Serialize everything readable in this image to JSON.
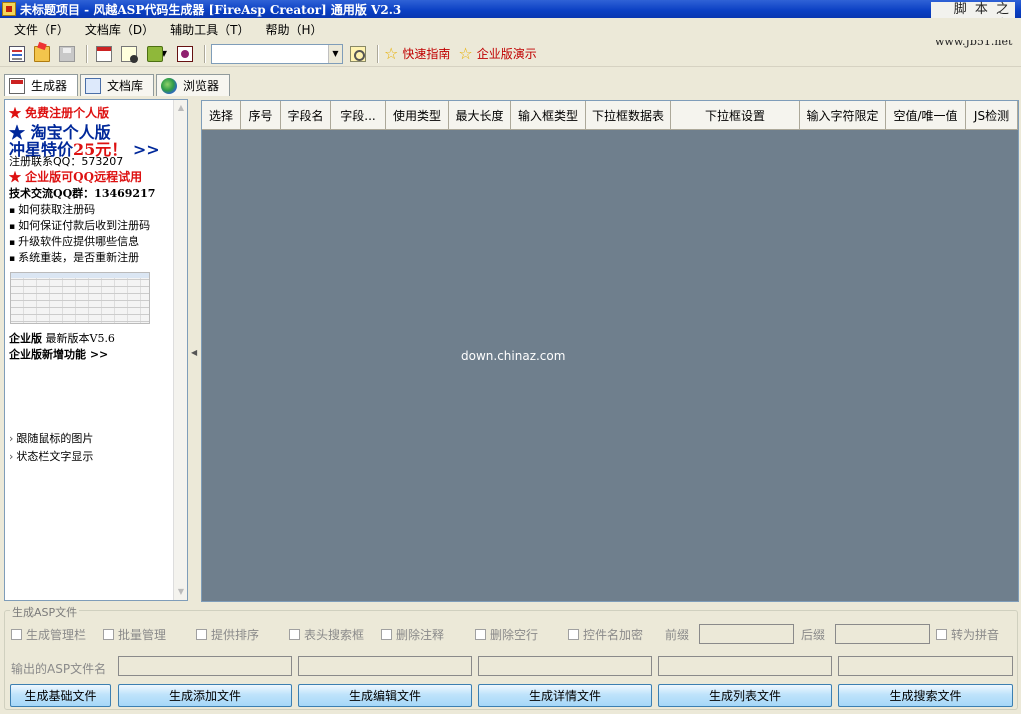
{
  "window": {
    "title": "未标题项目 - 风越ASP代码生成器 [FireAsp Creator] 通用版 V2.3"
  },
  "watermark": {
    "line1": "脚 本 之 家",
    "line2": "www.Jb51.net"
  },
  "menu": [
    "文件（F）",
    "文档库（D）",
    "辅助工具（T）",
    "帮助（H）"
  ],
  "toolbar": {
    "combo_value": "",
    "links": [
      "快速指南",
      "企业版演示"
    ]
  },
  "tabs": [
    {
      "label": "生成器",
      "active": true
    },
    {
      "label": "文档库",
      "active": false
    },
    {
      "label": "浏览器",
      "active": false
    }
  ],
  "leftpanel": {
    "reg_title": "★ 免费注册个人版",
    "taobao_line1": "★ 淘宝个人版",
    "taobao_line2_prefix": "冲星特价",
    "taobao_line2_price": "25元！",
    "taobao_line2_suffix": " >>",
    "reg_qq": "注册联系QQ：573207",
    "enterprise_qq": "★ 企业版可QQ远程试用",
    "tech_group": "技术交流QQ群：13469217",
    "bullets": [
      "如何获取注册码",
      "如何保证付款后收到注册码",
      "升级软件应提供哪些信息",
      "系统重装，是否重新注册"
    ],
    "version_label": "企业版",
    "version_text": " 最新版本V5.6",
    "new_features": "企业版新增功能 >>",
    "links": [
      "跟随鼠标的图片",
      "状态栏文字显示"
    ]
  },
  "grid": {
    "columns": [
      "选择",
      "序号",
      "字段名",
      "字段...",
      "使用类型",
      "最大长度",
      "输入框类型",
      "下拉框数据表",
      "下拉框设置",
      "输入字符限定",
      "空值/唯一值",
      "JS检测"
    ],
    "watermark": "down.chinaz.com"
  },
  "generate": {
    "group_label": "生成ASP文件",
    "options": [
      "生成管理栏",
      "批量管理",
      "提供排序",
      "表头搜索框",
      "删除注释",
      "删除空行",
      "控件名加密"
    ],
    "prefix_label": "前缀",
    "suffix_label": "后缀",
    "pinyin_label": "转为拼音",
    "output_label": "输出的ASP文件名",
    "buttons": [
      "生成基础文件",
      "生成添加文件",
      "生成编辑文件",
      "生成详情文件",
      "生成列表文件",
      "生成搜索文件"
    ]
  }
}
